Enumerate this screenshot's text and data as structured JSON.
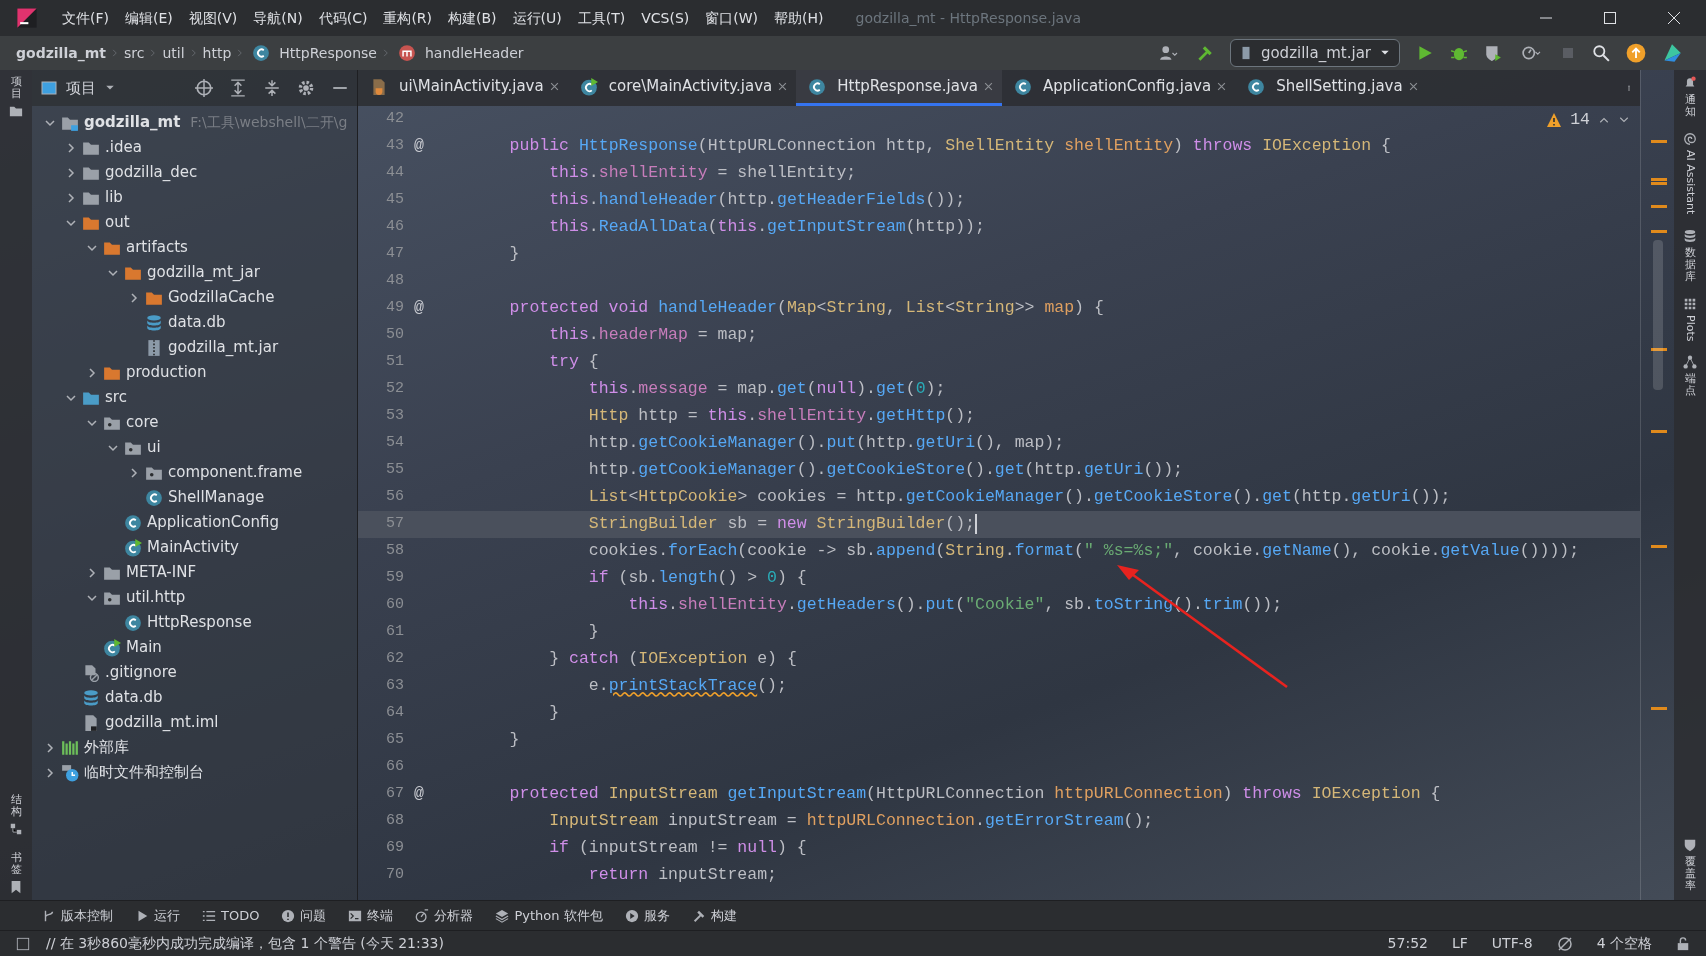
{
  "window": {
    "title": "godzilla_mt - HttpResponse.java"
  },
  "menu": [
    "文件(F)",
    "编辑(E)",
    "视图(V)",
    "导航(N)",
    "代码(C)",
    "重构(R)",
    "构建(B)",
    "运行(U)",
    "工具(T)",
    "VCS(S)",
    "窗口(W)",
    "帮助(H)"
  ],
  "breadcrumbs": [
    {
      "label": "godzilla_mt"
    },
    {
      "label": "src"
    },
    {
      "label": "util"
    },
    {
      "label": "http"
    },
    {
      "label": "HttpResponse",
      "kind": "class"
    },
    {
      "label": "handleHeader",
      "kind": "method"
    }
  ],
  "run_config": {
    "label": "godzilla_mt.jar"
  },
  "project_panel": {
    "title": "项目",
    "left_strip": [
      "项目"
    ],
    "bottom_strip": [
      "结构",
      "书签"
    ]
  },
  "tree": [
    {
      "name": "godzilla_mt",
      "kind": "module",
      "path": "F:\\工具\\webshell\\二开\\g",
      "expanded": true,
      "children": [
        {
          "name": ".idea",
          "kind": "folder",
          "expanded": false
        },
        {
          "name": "godzilla_dec",
          "kind": "folder",
          "expanded": false
        },
        {
          "name": "lib",
          "kind": "folder",
          "expanded": false
        },
        {
          "name": "out",
          "kind": "output",
          "expanded": true,
          "children": [
            {
              "name": "artifacts",
              "kind": "output",
              "expanded": true,
              "children": [
                {
                  "name": "godzilla_mt_jar",
                  "kind": "output",
                  "expanded": true,
                  "children": [
                    {
                      "name": "GodzillaCache",
                      "kind": "output",
                      "expanded": false
                    },
                    {
                      "name": "data.db",
                      "kind": "db"
                    },
                    {
                      "name": "godzilla_mt.jar",
                      "kind": "jar"
                    }
                  ]
                }
              ]
            },
            {
              "name": "production",
              "kind": "output",
              "expanded": false
            }
          ]
        },
        {
          "name": "src",
          "kind": "source",
          "expanded": true,
          "children": [
            {
              "name": "core",
              "kind": "package",
              "expanded": true,
              "children": [
                {
                  "name": "ui",
                  "kind": "package",
                  "expanded": true,
                  "children": [
                    {
                      "name": "component.frame",
                      "kind": "package",
                      "expanded": false
                    },
                    {
                      "name": "ShellManage",
                      "kind": "class"
                    }
                  ]
                },
                {
                  "name": "ApplicationConfig",
                  "kind": "class"
                },
                {
                  "name": "MainActivity",
                  "kind": "runnable"
                }
              ]
            },
            {
              "name": "META-INF",
              "kind": "folder",
              "expanded": false
            },
            {
              "name": "util.http",
              "kind": "package",
              "expanded": true,
              "children": [
                {
                  "name": "HttpResponse",
                  "kind": "class"
                }
              ]
            },
            {
              "name": "Main",
              "kind": "runnable"
            }
          ]
        },
        {
          "name": ".gitignore",
          "kind": "ignore"
        },
        {
          "name": "data.db",
          "kind": "db"
        },
        {
          "name": "godzilla_mt.iml",
          "kind": "file"
        }
      ]
    },
    {
      "name": "外部库",
      "kind": "library",
      "expanded": false
    },
    {
      "name": "临时文件和控制台",
      "kind": "scratch",
      "expanded": false
    }
  ],
  "tabs": [
    {
      "label": "ui\\MainActivity.java",
      "kind": "java",
      "selected": false
    },
    {
      "label": "core\\MainActivity.java",
      "kind": "runnable",
      "selected": false
    },
    {
      "label": "HttpResponse.java",
      "kind": "class",
      "selected": true
    },
    {
      "label": "ApplicationConfig.java",
      "kind": "class",
      "selected": false
    },
    {
      "label": "ShellSetting.java",
      "kind": "class",
      "selected": false
    }
  ],
  "inspection": {
    "count": "14"
  },
  "code": [
    {
      "n": "42",
      "current": false
    },
    {
      "n": "43",
      "marker": "@",
      "current": false,
      "tokens": [
        {
          "kind": "keyword",
          "text": "    public "
        },
        {
          "kind": "method",
          "text": "HttpResponse"
        },
        {
          "kind": "plain",
          "text": "(HttpURLConnection http, "
        },
        {
          "kind": "type",
          "text": "ShellEntity "
        },
        {
          "kind": "param",
          "text": "shellEntity"
        },
        {
          "kind": "plain",
          "text": ") "
        },
        {
          "kind": "keyword",
          "text": "throws "
        },
        {
          "kind": "type",
          "text": "IOException"
        },
        {
          "kind": "plain",
          "text": " {"
        }
      ]
    },
    {
      "n": "44",
      "current": false,
      "tokens": [
        {
          "kind": "keyword",
          "text": "        this"
        },
        {
          "kind": "plain",
          "text": "."
        },
        {
          "kind": "field",
          "text": "shellEntity"
        },
        {
          "kind": "plain",
          "text": " = shellEntity;"
        }
      ]
    },
    {
      "n": "45",
      "current": false,
      "tokens": [
        {
          "kind": "keyword",
          "text": "        this"
        },
        {
          "kind": "plain",
          "text": "."
        },
        {
          "kind": "method",
          "text": "handleHeader"
        },
        {
          "kind": "plain",
          "text": "(http."
        },
        {
          "kind": "method",
          "text": "getHeaderFields"
        },
        {
          "kind": "plain",
          "text": "());"
        }
      ]
    },
    {
      "n": "46",
      "current": false,
      "tokens": [
        {
          "kind": "keyword",
          "text": "        this"
        },
        {
          "kind": "plain",
          "text": "."
        },
        {
          "kind": "method",
          "text": "ReadAllData"
        },
        {
          "kind": "plain",
          "text": "("
        },
        {
          "kind": "keyword",
          "text": "this"
        },
        {
          "kind": "plain",
          "text": "."
        },
        {
          "kind": "method",
          "text": "getInputStream"
        },
        {
          "kind": "plain",
          "text": "(http));"
        }
      ]
    },
    {
      "n": "47",
      "current": false,
      "tokens": [
        {
          "kind": "plain",
          "text": "    }"
        }
      ]
    },
    {
      "n": "48",
      "current": false
    },
    {
      "n": "49",
      "marker": "@",
      "current": false,
      "tokens": [
        {
          "kind": "keyword",
          "text": "    protected void "
        },
        {
          "kind": "method",
          "text": "handleHeader"
        },
        {
          "kind": "plain",
          "text": "("
        },
        {
          "kind": "type",
          "text": "Map"
        },
        {
          "kind": "plain",
          "text": "<"
        },
        {
          "kind": "type",
          "text": "String"
        },
        {
          "kind": "plain",
          "text": ", "
        },
        {
          "kind": "type",
          "text": "List"
        },
        {
          "kind": "plain",
          "text": "<"
        },
        {
          "kind": "type",
          "text": "String"
        },
        {
          "kind": "plain",
          "text": ">> "
        },
        {
          "kind": "param",
          "text": "map"
        },
        {
          "kind": "plain",
          "text": ") {"
        }
      ]
    },
    {
      "n": "50",
      "current": false,
      "tokens": [
        {
          "kind": "keyword",
          "text": "        this"
        },
        {
          "kind": "plain",
          "text": "."
        },
        {
          "kind": "field",
          "text": "headerMap"
        },
        {
          "kind": "plain",
          "text": " = map;"
        }
      ]
    },
    {
      "n": "51",
      "current": false,
      "tokens": [
        {
          "kind": "keyword",
          "text": "        try"
        },
        {
          "kind": "plain",
          "text": " {"
        }
      ]
    },
    {
      "n": "52",
      "current": false,
      "tokens": [
        {
          "kind": "keyword",
          "text": "            this"
        },
        {
          "kind": "plain",
          "text": "."
        },
        {
          "kind": "field",
          "text": "message"
        },
        {
          "kind": "plain",
          "text": " = map."
        },
        {
          "kind": "method",
          "text": "get"
        },
        {
          "kind": "plain",
          "text": "("
        },
        {
          "kind": "keyword",
          "text": "null"
        },
        {
          "kind": "plain",
          "text": ")."
        },
        {
          "kind": "method",
          "text": "get"
        },
        {
          "kind": "plain",
          "text": "("
        },
        {
          "kind": "number",
          "text": "0"
        },
        {
          "kind": "plain",
          "text": ");"
        }
      ]
    },
    {
      "n": "53",
      "current": false,
      "tokens": [
        {
          "kind": "type",
          "text": "            Http"
        },
        {
          "kind": "plain",
          "text": " http = "
        },
        {
          "kind": "keyword",
          "text": "this"
        },
        {
          "kind": "plain",
          "text": "."
        },
        {
          "kind": "field",
          "text": "shellEntity"
        },
        {
          "kind": "plain",
          "text": "."
        },
        {
          "kind": "method",
          "text": "getHttp"
        },
        {
          "kind": "plain",
          "text": "();"
        }
      ]
    },
    {
      "n": "54",
      "current": false,
      "tokens": [
        {
          "kind": "plain",
          "text": "            http."
        },
        {
          "kind": "method",
          "text": "getCookieManager"
        },
        {
          "kind": "plain",
          "text": "()."
        },
        {
          "kind": "method",
          "text": "put"
        },
        {
          "kind": "plain",
          "text": "(http."
        },
        {
          "kind": "method",
          "text": "getUri"
        },
        {
          "kind": "plain",
          "text": "(), map);"
        }
      ]
    },
    {
      "n": "55",
      "current": false,
      "tokens": [
        {
          "kind": "plain",
          "text": "            http."
        },
        {
          "kind": "method",
          "text": "getCookieManager"
        },
        {
          "kind": "plain",
          "text": "()."
        },
        {
          "kind": "method",
          "text": "getCookieStore"
        },
        {
          "kind": "plain",
          "text": "()."
        },
        {
          "kind": "method",
          "text": "get"
        },
        {
          "kind": "plain",
          "text": "(http."
        },
        {
          "kind": "method",
          "text": "getUri"
        },
        {
          "kind": "plain",
          "text": "());"
        }
      ]
    },
    {
      "n": "56",
      "current": false,
      "tokens": [
        {
          "kind": "type",
          "text": "            List"
        },
        {
          "kind": "plain",
          "text": "<"
        },
        {
          "kind": "type",
          "text": "HttpCookie"
        },
        {
          "kind": "plain",
          "text": "> cookies = http."
        },
        {
          "kind": "method",
          "text": "getCookieManager"
        },
        {
          "kind": "plain",
          "text": "()."
        },
        {
          "kind": "method",
          "text": "getCookieStore"
        },
        {
          "kind": "plain",
          "text": "()."
        },
        {
          "kind": "method",
          "text": "get"
        },
        {
          "kind": "plain",
          "text": "(http."
        },
        {
          "kind": "method",
          "text": "getUri"
        },
        {
          "kind": "plain",
          "text": "());"
        }
      ]
    },
    {
      "n": "57",
      "current": true,
      "tokens": [
        {
          "kind": "type",
          "text": "            StringBuilder"
        },
        {
          "kind": "plain",
          "text": " sb = "
        },
        {
          "kind": "keyword",
          "text": "new "
        },
        {
          "kind": "type",
          "text": "StringBuilder"
        },
        {
          "kind": "plain",
          "text": "();"
        }
      ]
    },
    {
      "n": "58",
      "current": false,
      "tokens": [
        {
          "kind": "plain",
          "text": "            cookies."
        },
        {
          "kind": "method",
          "text": "forEach"
        },
        {
          "kind": "plain",
          "text": "(cookie -> sb."
        },
        {
          "kind": "method",
          "text": "append"
        },
        {
          "kind": "plain",
          "text": "("
        },
        {
          "kind": "type",
          "text": "String"
        },
        {
          "kind": "plain",
          "text": "."
        },
        {
          "kind": "method",
          "text": "format"
        },
        {
          "kind": "plain",
          "text": "("
        },
        {
          "kind": "string",
          "text": "\" %s=%s;\""
        },
        {
          "kind": "plain",
          "text": ", cookie."
        },
        {
          "kind": "method",
          "text": "getName"
        },
        {
          "kind": "plain",
          "text": "(), cookie."
        },
        {
          "kind": "method",
          "text": "getValue"
        },
        {
          "kind": "plain",
          "text": "())));"
        }
      ]
    },
    {
      "n": "59",
      "current": false,
      "tokens": [
        {
          "kind": "keyword",
          "text": "            if"
        },
        {
          "kind": "plain",
          "text": " (sb."
        },
        {
          "kind": "method",
          "text": "length"
        },
        {
          "kind": "plain",
          "text": "() > "
        },
        {
          "kind": "number",
          "text": "0"
        },
        {
          "kind": "plain",
          "text": ") {"
        }
      ]
    },
    {
      "n": "60",
      "current": false,
      "tokens": [
        {
          "kind": "keyword",
          "text": "                this"
        },
        {
          "kind": "plain",
          "text": "."
        },
        {
          "kind": "field",
          "text": "shellEntity"
        },
        {
          "kind": "plain",
          "text": "."
        },
        {
          "kind": "method",
          "text": "getHeaders"
        },
        {
          "kind": "plain",
          "text": "()."
        },
        {
          "kind": "method",
          "text": "put"
        },
        {
          "kind": "plain",
          "text": "("
        },
        {
          "kind": "string",
          "text": "\"Cookie\""
        },
        {
          "kind": "plain",
          "text": ", sb."
        },
        {
          "kind": "method",
          "text": "toString"
        },
        {
          "kind": "plain",
          "text": "()."
        },
        {
          "kind": "method",
          "text": "trim"
        },
        {
          "kind": "plain",
          "text": "());"
        }
      ]
    },
    {
      "n": "61",
      "current": false,
      "tokens": [
        {
          "kind": "plain",
          "text": "            }"
        }
      ]
    },
    {
      "n": "62",
      "current": false,
      "tokens": [
        {
          "kind": "plain",
          "text": "        } "
        },
        {
          "kind": "keyword",
          "text": "catch"
        },
        {
          "kind": "plain",
          "text": " ("
        },
        {
          "kind": "type",
          "text": "IOException"
        },
        {
          "kind": "plain",
          "text": " e) {"
        }
      ]
    },
    {
      "n": "63",
      "current": false,
      "tokens": [
        {
          "kind": "plain",
          "text": "            e."
        },
        {
          "kind": "warning",
          "text": "printStackTrace"
        },
        {
          "kind": "plain",
          "text": "();"
        }
      ]
    },
    {
      "n": "64",
      "current": false,
      "tokens": [
        {
          "kind": "plain",
          "text": "        }"
        }
      ]
    },
    {
      "n": "65",
      "current": false,
      "tokens": [
        {
          "kind": "plain",
          "text": "    }"
        }
      ]
    },
    {
      "n": "66",
      "current": false
    },
    {
      "n": "67",
      "marker": "@",
      "current": false,
      "tokens": [
        {
          "kind": "keyword",
          "text": "    protected "
        },
        {
          "kind": "type",
          "text": "InputStream "
        },
        {
          "kind": "method",
          "text": "getInputStream"
        },
        {
          "kind": "plain",
          "text": "(HttpURLConnection "
        },
        {
          "kind": "param",
          "text": "httpURLConnection"
        },
        {
          "kind": "plain",
          "text": ") "
        },
        {
          "kind": "keyword",
          "text": "throws "
        },
        {
          "kind": "type",
          "text": "IOException"
        },
        {
          "kind": "plain",
          "text": " {"
        }
      ]
    },
    {
      "n": "68",
      "current": false,
      "tokens": [
        {
          "kind": "type",
          "text": "        InputStream"
        },
        {
          "kind": "plain",
          "text": " inputStream = "
        },
        {
          "kind": "param",
          "text": "httpURLConnection"
        },
        {
          "kind": "plain",
          "text": "."
        },
        {
          "kind": "method",
          "text": "getErrorStream"
        },
        {
          "kind": "plain",
          "text": "();"
        }
      ]
    },
    {
      "n": "69",
      "current": false,
      "tokens": [
        {
          "kind": "keyword",
          "text": "        if"
        },
        {
          "kind": "plain",
          "text": " (inputStream != "
        },
        {
          "kind": "keyword",
          "text": "null"
        },
        {
          "kind": "plain",
          "text": ") {"
        }
      ]
    },
    {
      "n": "70",
      "current": false,
      "tokens": [
        {
          "kind": "keyword",
          "text": "            return"
        },
        {
          "kind": "plain",
          "text": " inputStream;"
        }
      ]
    }
  ],
  "right_strip": [
    {
      "label": "通知",
      "kind": "bell"
    },
    {
      "label": "AI Assistant",
      "kind": "swirl"
    },
    {
      "label": "数据库",
      "kind": "database"
    },
    {
      "label": "Plots",
      "kind": "grid"
    },
    {
      "label": "端点",
      "kind": "nodes"
    },
    {
      "label": "覆盖率",
      "kind": "shield"
    }
  ],
  "tool_windows": [
    {
      "label": "版本控制",
      "kind": "branch"
    },
    {
      "label": "运行",
      "kind": "play"
    },
    {
      "label": "TODO",
      "kind": "list"
    },
    {
      "label": "问题",
      "kind": "alert"
    },
    {
      "label": "终端",
      "kind": "terminal"
    },
    {
      "label": "分析器",
      "kind": "gauge"
    },
    {
      "label": "Python 软件包",
      "kind": "layers"
    },
    {
      "label": "服务",
      "kind": "play-circle"
    },
    {
      "label": "构建",
      "kind": "hammer"
    }
  ],
  "status_bar": {
    "message": "// 在 3秒860毫秒内成功完成编译，包含 1 个警告 (今天 21:33)",
    "position": "57:52",
    "line_ending": "LF",
    "encoding": "UTF-8",
    "indent": "4 个空格"
  }
}
